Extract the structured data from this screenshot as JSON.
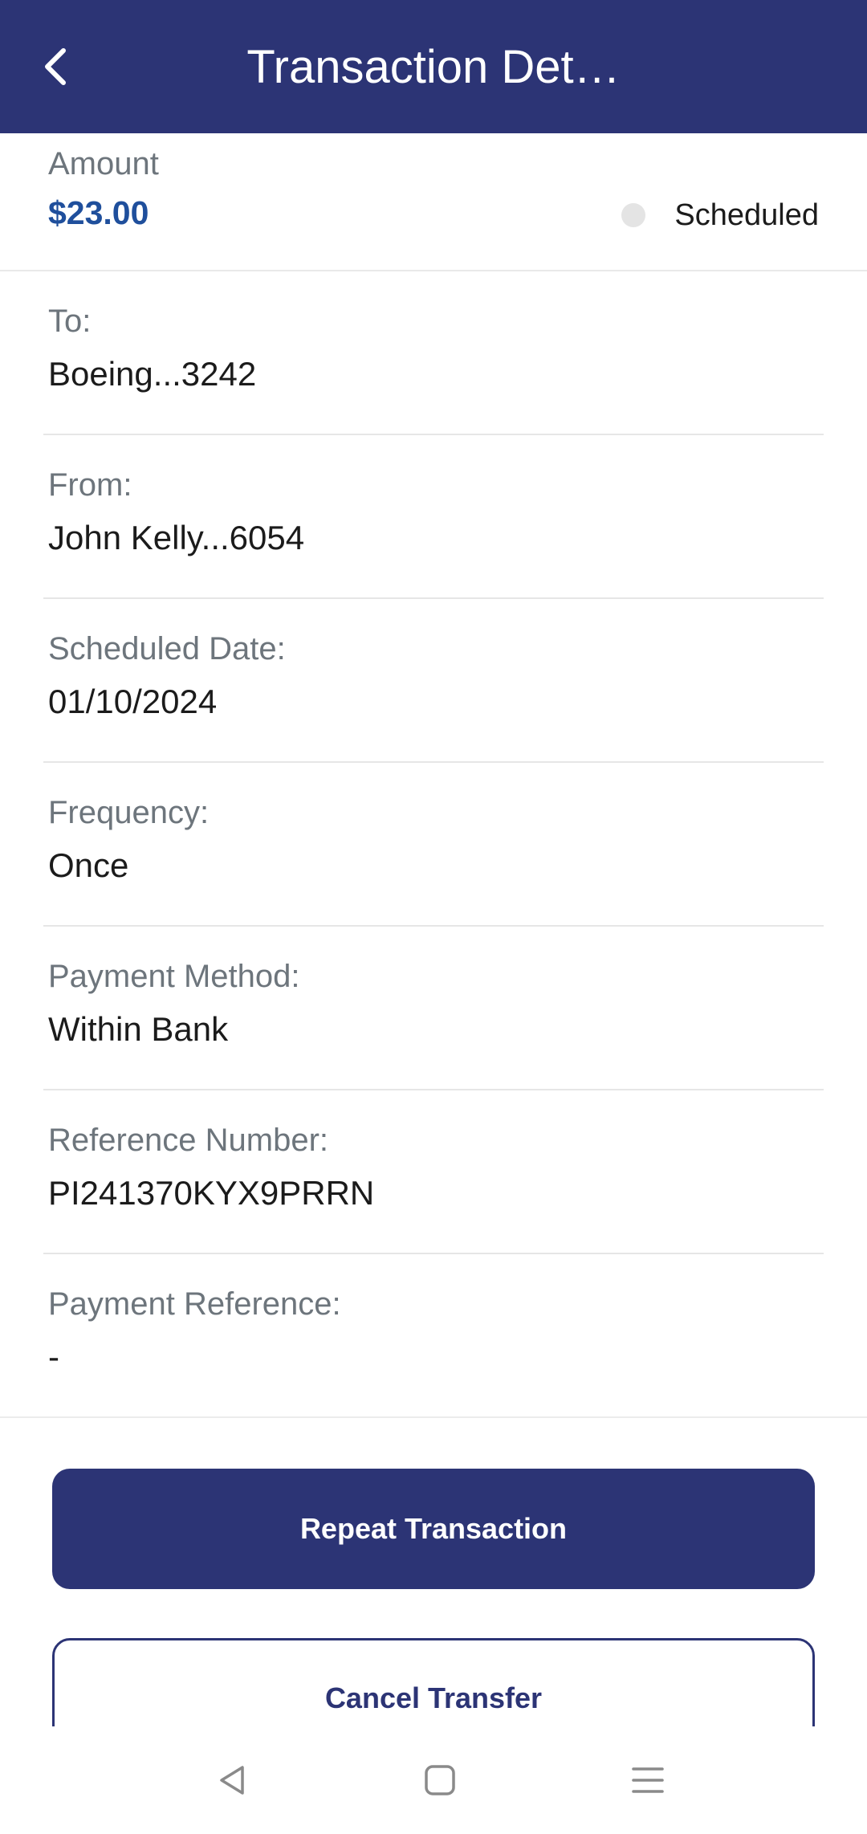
{
  "header": {
    "title": "Transaction Det…",
    "back_icon": "chevron-left-icon"
  },
  "amount": {
    "label": "Amount",
    "value": "$23.00",
    "status": "Scheduled"
  },
  "details": [
    {
      "label": "To:",
      "value": "Boeing...3242"
    },
    {
      "label": "From:",
      "value": "John Kelly...6054"
    },
    {
      "label": "Scheduled Date:",
      "value": "01/10/2024"
    },
    {
      "label": "Frequency:",
      "value": "Once"
    },
    {
      "label": "Payment Method:",
      "value": "Within Bank"
    },
    {
      "label": "Reference Number:",
      "value": "PI241370KYX9PRRN"
    },
    {
      "label": "Payment Reference:",
      "value": "-"
    }
  ],
  "actions": {
    "repeat_label": "Repeat Transaction",
    "cancel_label": "Cancel Transfer"
  },
  "system_nav": {
    "back_icon": "triangle-back-icon",
    "home_icon": "square-home-icon",
    "menu_icon": "menu-lines-icon"
  },
  "colors": {
    "brand": "#2c3475",
    "amount": "#1f4f9c",
    "label": "#6d757c",
    "status_dot": "#e4e4e4"
  }
}
